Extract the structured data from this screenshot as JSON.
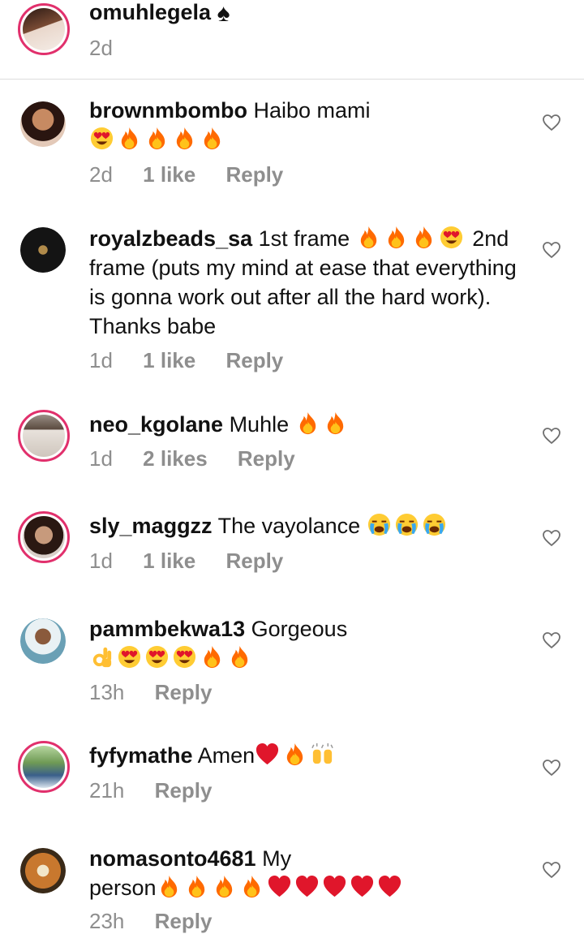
{
  "caption": {
    "username": "omuhlegela",
    "suffix": "♠",
    "time": "2d"
  },
  "comments": [
    {
      "username": "brownmbombo",
      "text": "Haibo mami",
      "time": "2d",
      "likes": "1 like",
      "reply": "Reply"
    },
    {
      "username": "royalzbeads_sa",
      "text1": "1st frame",
      "text2": "2nd frame (puts my mind at ease that everything is gonna work out after all the hard work). Thanks babe",
      "time": "1d",
      "likes": "1 like",
      "reply": "Reply"
    },
    {
      "username": "neo_kgolane",
      "text": "Muhle",
      "time": "1d",
      "likes": "2 likes",
      "reply": "Reply"
    },
    {
      "username": "sly_maggzz",
      "text": "The vayolance",
      "time": "1d",
      "likes": "1 like",
      "reply": "Reply"
    },
    {
      "username": "pammbekwa13",
      "text": "Gorgeous",
      "time": "13h",
      "reply": "Reply"
    },
    {
      "username": "fyfymathe",
      "text": "Amen",
      "time": "21h",
      "reply": "Reply"
    },
    {
      "username": "nomasonto4681",
      "text1": "My",
      "text2": "person",
      "time": "23h",
      "reply": "Reply"
    }
  ],
  "colors": {
    "muted": "#8e8e8e",
    "fire": "#ff6a00",
    "heart": "#e0162b",
    "ring": "#e1306c"
  }
}
